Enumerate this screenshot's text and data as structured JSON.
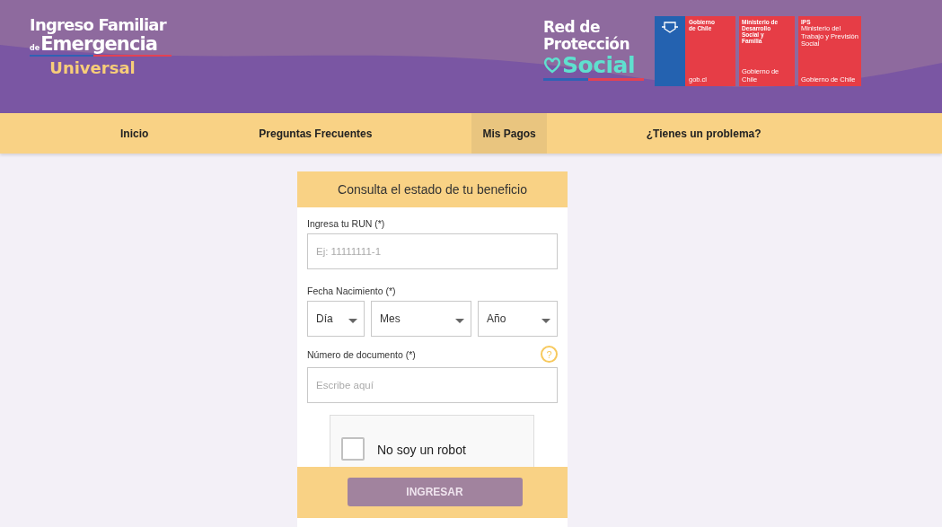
{
  "header": {
    "logo": {
      "line_1": "Ingreso Familiar",
      "prefix": "de",
      "line_2": "Emergencia",
      "line_3": "Universal"
    },
    "network_logo": {
      "line_1": "Red de",
      "line_2": "Protección",
      "line_3": "Social"
    },
    "institutions": [
      {
        "lines": [
          "Gobierno",
          "de Chile"
        ],
        "footer": "gob.cl",
        "color": "#2462b0"
      },
      {
        "lines": [
          "Ministerio de",
          "Desarrollo",
          "Social y",
          "Familia"
        ],
        "footer": "Gobierno de Chile",
        "color": "#e63d46"
      },
      {
        "lines": [
          "IPS",
          "Ministerio del Trabajo y Previsión Social"
        ],
        "footer": "Gobierno de Chile",
        "color": "#e63d46"
      }
    ]
  },
  "nav": [
    {
      "label": "Inicio",
      "selected": false
    },
    {
      "label": "Preguntas Frecuentes",
      "selected": false
    },
    {
      "label": "Mis Pagos",
      "selected": true
    },
    {
      "label": "¿Tienes un problema?",
      "selected": false
    }
  ],
  "form": {
    "title": "Consulta el estado de tu beneficio",
    "run": {
      "label": "Ingresa tu RUN (*)",
      "placeholder": "Ej: 11111111-1"
    },
    "birth": {
      "label": "Fecha Nacimiento (*)",
      "selects": [
        "Día",
        "Mes",
        "Año"
      ]
    },
    "document": {
      "label": "Número de documento (*)",
      "help": "?",
      "placeholder": "Escribe aquí"
    },
    "captcha": {
      "label": "No soy un robot",
      "checked": false
    },
    "submit": "INGRESAR"
  }
}
